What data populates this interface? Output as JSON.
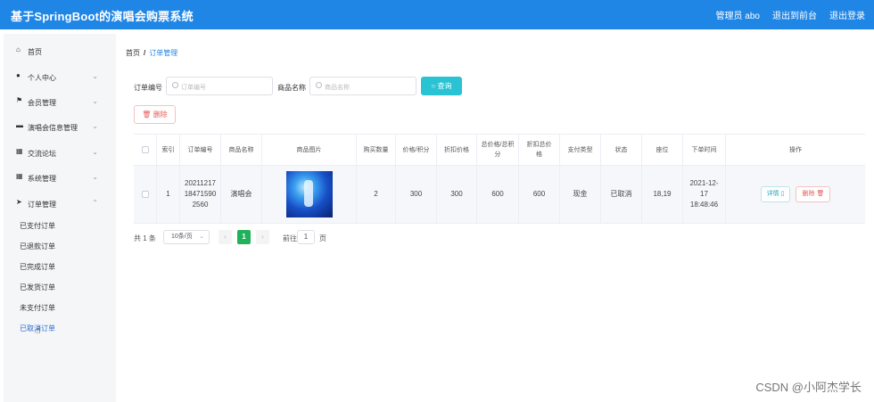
{
  "header": {
    "title": "基于SpringBoot的演唱会购票系统",
    "user": "管理员 abo",
    "exit_to_front": "退出到前台",
    "logout": "退出登录"
  },
  "sidebar": {
    "items": [
      {
        "label": "首页",
        "icon": "home-icon"
      },
      {
        "label": "个人中心",
        "icon": "user-icon"
      },
      {
        "label": "会员管理",
        "icon": "flag-icon"
      },
      {
        "label": "演唱会信息管理",
        "icon": "book-icon"
      },
      {
        "label": "交流论坛",
        "icon": "grid-icon"
      },
      {
        "label": "系统管理",
        "icon": "grid-icon"
      },
      {
        "label": "订单管理",
        "icon": "send-icon"
      }
    ],
    "order_sub": [
      "已支付订单",
      "已退款订单",
      "已完成订单",
      "已发货订单",
      "未支付订单",
      "已取消订单"
    ]
  },
  "breadcrumb": {
    "home": "首页",
    "sep": "/",
    "current": "订单管理"
  },
  "search": {
    "order_no_label": "订单编号",
    "order_no_placeholder": "订单编号",
    "product_label": "商品名称",
    "product_placeholder": "商品名称",
    "query_label": "查询"
  },
  "toolbar": {
    "delete_label": "删除"
  },
  "table": {
    "headers": [
      "索引",
      "订单编号",
      "商品名称",
      "商品图片",
      "购买数量",
      "价格/积分",
      "折扣价格",
      "总价格/总积分",
      "折扣总价格",
      "支付类型",
      "状态",
      "座位",
      "下单时间",
      "操作"
    ],
    "row": {
      "index": "1",
      "order_no": "20211217184715902560",
      "product": "演唱会",
      "qty": "2",
      "price": "300",
      "discount": "300",
      "total": "600",
      "discount_total": "600",
      "pay_type": "现金",
      "status": "已取消",
      "seat": "18,19",
      "time": "2021-12-17 18:48:46",
      "detail_label": "详情",
      "delete_label": "删除"
    }
  },
  "pager": {
    "total": "共 1 条",
    "page_size": "10条/页",
    "page": "1",
    "goto": "前往",
    "goto_value": "1",
    "unit": "页"
  },
  "watermark": "CSDN @小阿杰学长"
}
